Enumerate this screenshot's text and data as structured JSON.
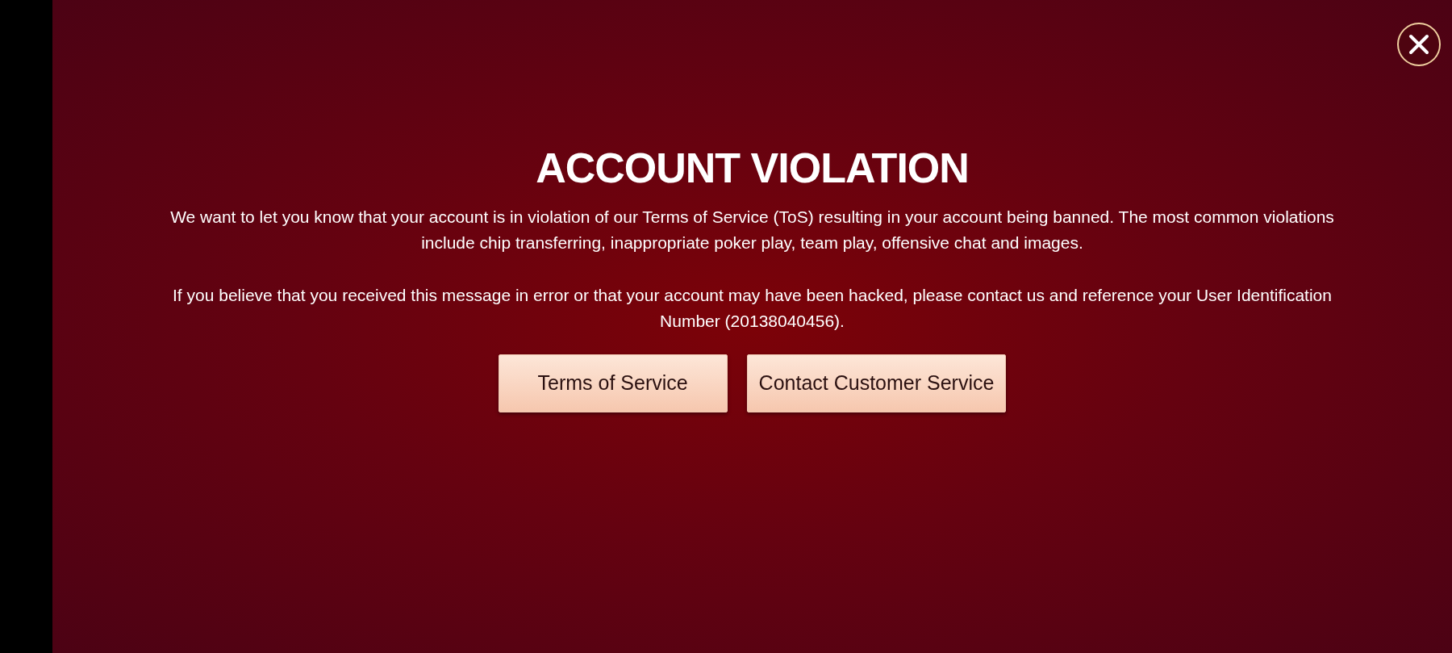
{
  "dialog": {
    "title": "ACCOUNT VIOLATION",
    "paragraphs": [
      "We want to let you know that your account is in violation of our Terms of Service (ToS) resulting in your account being banned. The most common violations include chip transferring, inappropriate poker play, team play, offensive chat and images.",
      "If you believe that you received this message in error or that your account may have been hacked, please contact us and reference your User Identification Number (20138040456)."
    ],
    "buttons": [
      {
        "label": "Terms of Service"
      },
      {
        "label": "Contact Customer Service"
      }
    ]
  }
}
